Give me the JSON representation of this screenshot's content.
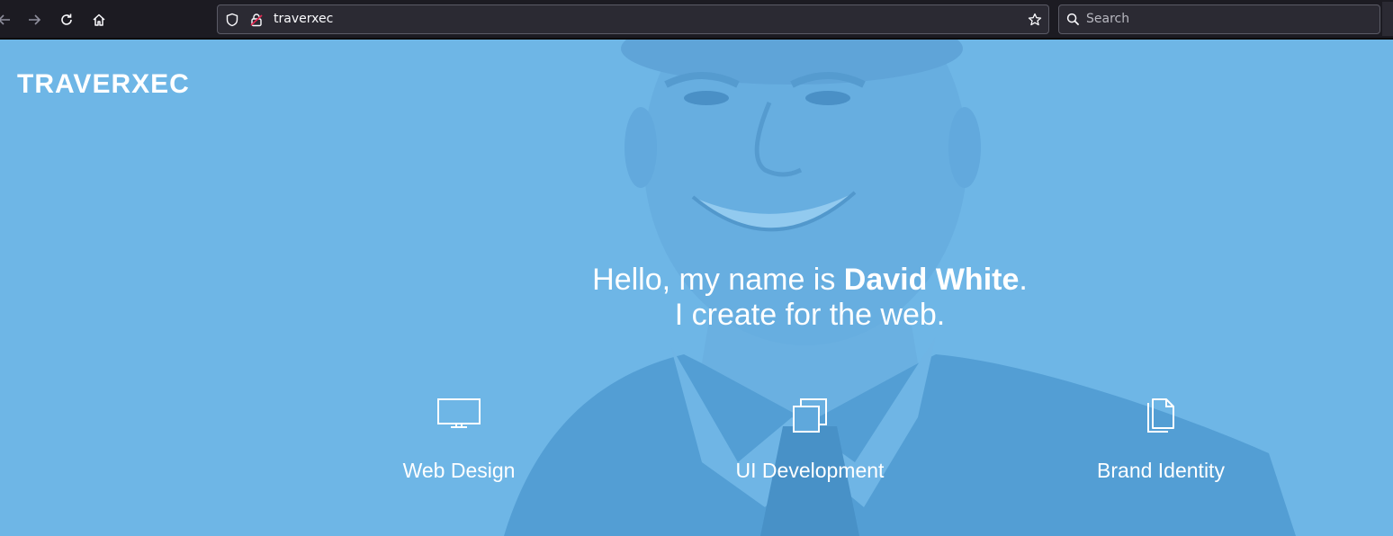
{
  "browser": {
    "url": "traverxec",
    "search_placeholder": "Search"
  },
  "page": {
    "brand": "TRAVERXEC",
    "headline": {
      "prefix": "Hello, my name is ",
      "name": "David White",
      "suffix": ".",
      "line2": "I create for the web."
    },
    "services": [
      {
        "label": "Web Design",
        "icon": "monitor-icon"
      },
      {
        "label": "UI Development",
        "icon": "stacked-squares-icon"
      },
      {
        "label": "Brand Identity",
        "icon": "documents-icon"
      }
    ]
  },
  "colors": {
    "toolbar": "#1c1b22",
    "urlbar": "#2b2a33",
    "hero_overlay": "#6cb4e4",
    "text": "#ffffff"
  }
}
